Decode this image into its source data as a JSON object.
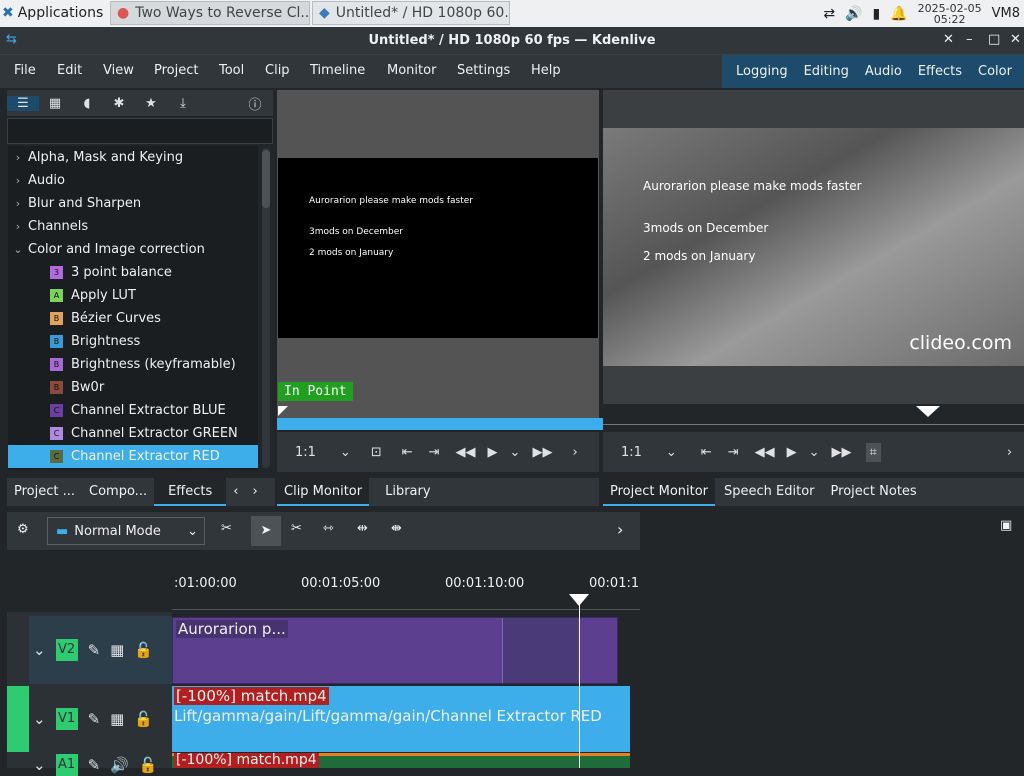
{
  "taskbar": {
    "applications": "Applications",
    "tab1": "Two Ways to Reverse Cl...",
    "tab2": "Untitled* / HD 1080p 60...",
    "date": "2025-02-05",
    "time": "05:22",
    "user": "VM8"
  },
  "window": {
    "title": "Untitled* / HD 1080p 60 fps — Kdenlive"
  },
  "menu": [
    "File",
    "Edit",
    "View",
    "Project",
    "Tool",
    "Clip",
    "Timeline",
    "Monitor",
    "Settings",
    "Help"
  ],
  "layouts": [
    "Logging",
    "Editing",
    "Audio",
    "Effects",
    "Color"
  ],
  "effects": {
    "categories": [
      "Alpha, Mask and Keying",
      "Audio",
      "Blur and Sharpen",
      "Channels",
      "Color and Image correction"
    ],
    "items": [
      {
        "badge": "3",
        "label": "3 point balance",
        "color": "#b06be0"
      },
      {
        "badge": "A",
        "label": "Apply LUT",
        "color": "#7bd35a"
      },
      {
        "badge": "B",
        "label": "Bézier Curves",
        "color": "#e0a35a"
      },
      {
        "badge": "B",
        "label": "Brightness",
        "color": "#3a9ad6"
      },
      {
        "badge": "B",
        "label": "Brightness (keyframable)",
        "color": "#a76bd6"
      },
      {
        "badge": "B",
        "label": "Bw0r",
        "color": "#8b4a3c"
      },
      {
        "badge": "C",
        "label": "Channel Extractor BLUE",
        "color": "#6b3fa0"
      },
      {
        "badge": "C",
        "label": "Channel Extractor GREEN",
        "color": "#b08ae0"
      },
      {
        "badge": "C",
        "label": "Channel Extractor RED",
        "color": "#5a6b3c"
      }
    ]
  },
  "clip_monitor": {
    "lines": [
      "Aurorarion please make mods faster",
      "3mods on December",
      "2 mods on January"
    ],
    "in_point": "In Point",
    "zoom": "1:1"
  },
  "project_monitor": {
    "lines": [
      "Aurorarion please make mods faster",
      "3mods on December",
      "2 mods on January"
    ],
    "watermark": "clideo.com",
    "zoom": "1:1"
  },
  "tabs_left": [
    "Project ...",
    "Compo...",
    "Effects"
  ],
  "tabs_mid": [
    "Clip Monitor",
    "Library"
  ],
  "tabs_right": [
    "Project Monitor",
    "Speech Editor",
    "Project Notes"
  ],
  "timeline": {
    "mode": "Normal Mode",
    "timecodes": [
      ":01:00:00",
      "00:01:05:00",
      "00:01:10:00",
      "00:01:1"
    ],
    "tracks": [
      "V2",
      "V1",
      "A1"
    ],
    "clip_v2": "Aurorarion p...",
    "clip_v1_name": "[-100%] match.mp4",
    "clip_v1_effects": "Lift/gamma/gain/Lift/gamma/gain/Channel Extractor RED",
    "clip_a1_name": "[-100%] match.mp4"
  }
}
